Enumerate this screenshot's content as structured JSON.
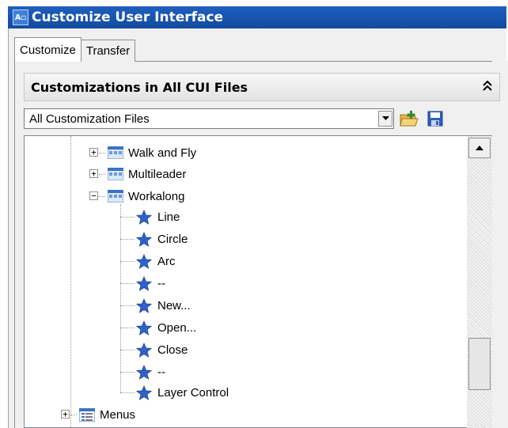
{
  "window": {
    "title": "Customize User Interface"
  },
  "tabs": [
    {
      "label": "Customize"
    },
    {
      "label": "Transfer"
    }
  ],
  "section": {
    "title": "Customizations in All CUI Files"
  },
  "file_selector": {
    "value": "All Customization Files"
  },
  "tree": {
    "toolbars": [
      {
        "label": "Walk and Fly",
        "expanded": false
      },
      {
        "label": "Multileader",
        "expanded": false
      },
      {
        "label": "Workalong",
        "expanded": true
      }
    ],
    "workalong_items": [
      {
        "label": "Line"
      },
      {
        "label": "Circle"
      },
      {
        "label": "Arc"
      },
      {
        "label": "--"
      },
      {
        "label": "New..."
      },
      {
        "label": "Open..."
      },
      {
        "label": "Close"
      },
      {
        "label": "--"
      },
      {
        "label": "Layer Control"
      }
    ],
    "menus": {
      "label": "Menus",
      "expanded": false
    }
  },
  "colors": {
    "titlebar": "#1a55b0",
    "star": "#2f62c8"
  },
  "icons": [
    "toolbar-icon",
    "command-star-icon",
    "menu-icon",
    "load-file-icon",
    "save-icon",
    "collapse-icon"
  ]
}
